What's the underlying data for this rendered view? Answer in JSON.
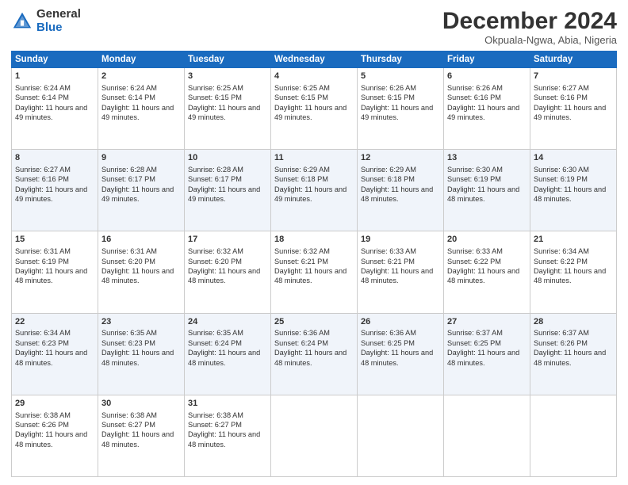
{
  "header": {
    "logo_general": "General",
    "logo_blue": "Blue",
    "month_title": "December 2024",
    "subtitle": "Okpuala-Ngwa, Abia, Nigeria"
  },
  "days_of_week": [
    "Sunday",
    "Monday",
    "Tuesday",
    "Wednesday",
    "Thursday",
    "Friday",
    "Saturday"
  ],
  "weeks": [
    [
      {
        "day": 1,
        "sunrise": "6:24 AM",
        "sunset": "6:14 PM",
        "daylight": "11 hours and 49 minutes."
      },
      {
        "day": 2,
        "sunrise": "6:24 AM",
        "sunset": "6:14 PM",
        "daylight": "11 hours and 49 minutes."
      },
      {
        "day": 3,
        "sunrise": "6:25 AM",
        "sunset": "6:15 PM",
        "daylight": "11 hours and 49 minutes."
      },
      {
        "day": 4,
        "sunrise": "6:25 AM",
        "sunset": "6:15 PM",
        "daylight": "11 hours and 49 minutes."
      },
      {
        "day": 5,
        "sunrise": "6:26 AM",
        "sunset": "6:15 PM",
        "daylight": "11 hours and 49 minutes."
      },
      {
        "day": 6,
        "sunrise": "6:26 AM",
        "sunset": "6:16 PM",
        "daylight": "11 hours and 49 minutes."
      },
      {
        "day": 7,
        "sunrise": "6:27 AM",
        "sunset": "6:16 PM",
        "daylight": "11 hours and 49 minutes."
      }
    ],
    [
      {
        "day": 8,
        "sunrise": "6:27 AM",
        "sunset": "6:16 PM",
        "daylight": "11 hours and 49 minutes."
      },
      {
        "day": 9,
        "sunrise": "6:28 AM",
        "sunset": "6:17 PM",
        "daylight": "11 hours and 49 minutes."
      },
      {
        "day": 10,
        "sunrise": "6:28 AM",
        "sunset": "6:17 PM",
        "daylight": "11 hours and 49 minutes."
      },
      {
        "day": 11,
        "sunrise": "6:29 AM",
        "sunset": "6:18 PM",
        "daylight": "11 hours and 49 minutes."
      },
      {
        "day": 12,
        "sunrise": "6:29 AM",
        "sunset": "6:18 PM",
        "daylight": "11 hours and 48 minutes."
      },
      {
        "day": 13,
        "sunrise": "6:30 AM",
        "sunset": "6:19 PM",
        "daylight": "11 hours and 48 minutes."
      },
      {
        "day": 14,
        "sunrise": "6:30 AM",
        "sunset": "6:19 PM",
        "daylight": "11 hours and 48 minutes."
      }
    ],
    [
      {
        "day": 15,
        "sunrise": "6:31 AM",
        "sunset": "6:19 PM",
        "daylight": "11 hours and 48 minutes."
      },
      {
        "day": 16,
        "sunrise": "6:31 AM",
        "sunset": "6:20 PM",
        "daylight": "11 hours and 48 minutes."
      },
      {
        "day": 17,
        "sunrise": "6:32 AM",
        "sunset": "6:20 PM",
        "daylight": "11 hours and 48 minutes."
      },
      {
        "day": 18,
        "sunrise": "6:32 AM",
        "sunset": "6:21 PM",
        "daylight": "11 hours and 48 minutes."
      },
      {
        "day": 19,
        "sunrise": "6:33 AM",
        "sunset": "6:21 PM",
        "daylight": "11 hours and 48 minutes."
      },
      {
        "day": 20,
        "sunrise": "6:33 AM",
        "sunset": "6:22 PM",
        "daylight": "11 hours and 48 minutes."
      },
      {
        "day": 21,
        "sunrise": "6:34 AM",
        "sunset": "6:22 PM",
        "daylight": "11 hours and 48 minutes."
      }
    ],
    [
      {
        "day": 22,
        "sunrise": "6:34 AM",
        "sunset": "6:23 PM",
        "daylight": "11 hours and 48 minutes."
      },
      {
        "day": 23,
        "sunrise": "6:35 AM",
        "sunset": "6:23 PM",
        "daylight": "11 hours and 48 minutes."
      },
      {
        "day": 24,
        "sunrise": "6:35 AM",
        "sunset": "6:24 PM",
        "daylight": "11 hours and 48 minutes."
      },
      {
        "day": 25,
        "sunrise": "6:36 AM",
        "sunset": "6:24 PM",
        "daylight": "11 hours and 48 minutes."
      },
      {
        "day": 26,
        "sunrise": "6:36 AM",
        "sunset": "6:25 PM",
        "daylight": "11 hours and 48 minutes."
      },
      {
        "day": 27,
        "sunrise": "6:37 AM",
        "sunset": "6:25 PM",
        "daylight": "11 hours and 48 minutes."
      },
      {
        "day": 28,
        "sunrise": "6:37 AM",
        "sunset": "6:26 PM",
        "daylight": "11 hours and 48 minutes."
      }
    ],
    [
      {
        "day": 29,
        "sunrise": "6:38 AM",
        "sunset": "6:26 PM",
        "daylight": "11 hours and 48 minutes."
      },
      {
        "day": 30,
        "sunrise": "6:38 AM",
        "sunset": "6:27 PM",
        "daylight": "11 hours and 48 minutes."
      },
      {
        "day": 31,
        "sunrise": "6:38 AM",
        "sunset": "6:27 PM",
        "daylight": "11 hours and 48 minutes."
      },
      null,
      null,
      null,
      null
    ]
  ]
}
